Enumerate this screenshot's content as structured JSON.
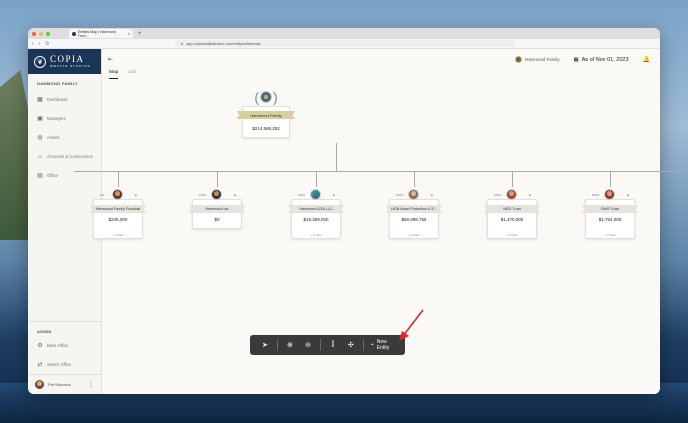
{
  "browser": {
    "tab_title": "Entities Map | Hammond Fami...",
    "url": "app.copiawealthstudios.com/entity/entitiesmap"
  },
  "sidebar": {
    "logo_name": "COPIA",
    "logo_sub": "WEALTH STUDIOS",
    "section": "HAMMOND FAMILY",
    "items": [
      {
        "label": "Dashboard",
        "icon": "grid-icon"
      },
      {
        "label": "Managers",
        "icon": "id-card-icon"
      },
      {
        "label": "Assets",
        "icon": "globe-icon"
      },
      {
        "label": "Accounts & Connections",
        "icon": "bank-icon"
      },
      {
        "label": "Office",
        "icon": "briefcase-icon"
      }
    ],
    "admin_section": "ADMIN",
    "admin_items": [
      {
        "label": "Back Office",
        "icon": "gear-icon"
      },
      {
        "label": "Switch Office",
        "icon": "swap-icon"
      }
    ],
    "user": "Pat Wheaton"
  },
  "topbar": {
    "family": "Hammond Family",
    "date": "As of Nov 01, 2023"
  },
  "tabs": {
    "map": "Map",
    "list": "List"
  },
  "root": {
    "name": "Hammond Family",
    "value": "$214,588,252"
  },
  "children": [
    {
      "name": "Hammond Family Foundati",
      "value": "$245,000",
      "pct": "0%",
      "more": "+ 2 New"
    },
    {
      "name": "Hammond Inc",
      "value": "$0",
      "pct": "100%",
      "more": ""
    },
    {
      "name": "Hammond USA LLC",
      "value": "$19,359,000",
      "pct": "100%",
      "more": "+ 1 New"
    },
    {
      "name": "HCM Asset Protection & E...",
      "value": "$69,098,756",
      "pct": "100%",
      "more": "+ 4 New"
    },
    {
      "name": "MES Trust",
      "value": "$1,470,000",
      "pct": "100%",
      "more": "+ 3 New"
    },
    {
      "name": "RMS Trust",
      "value": "$1,764,000",
      "pct": "100%",
      "more": "+ 2 New"
    }
  ],
  "toolbar": {
    "new_entity": "New Entity"
  }
}
